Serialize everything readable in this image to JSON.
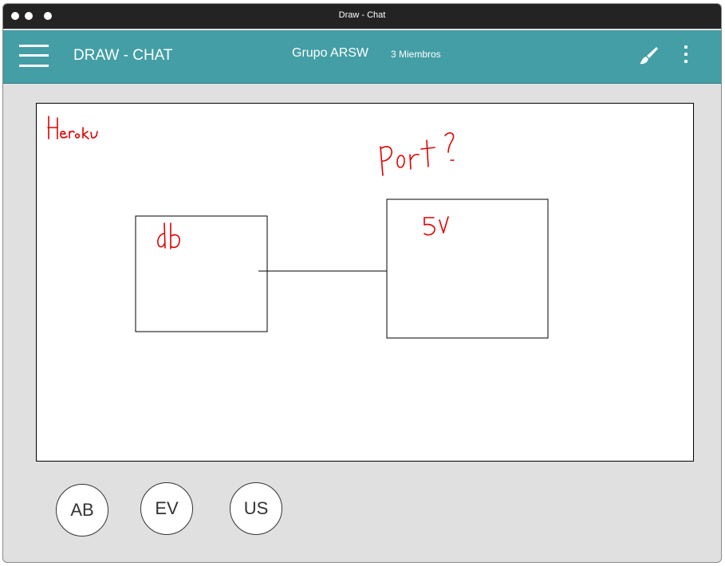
{
  "window": {
    "title": "Draw - Chat"
  },
  "appbar": {
    "app_name": "DRAW - CHAT",
    "group_name": "Grupo ARSW",
    "members": "3 Miembros",
    "color": "#439ea5"
  },
  "canvas": {
    "annotations": [
      "Heroku",
      "Port?",
      "db",
      "SV"
    ],
    "stroke_color": "#e00000"
  },
  "members_list": [
    {
      "initials": "AB"
    },
    {
      "initials": "EV"
    },
    {
      "initials": "US"
    }
  ],
  "icons": [
    "menu-icon",
    "brush-icon",
    "more-vert-icon"
  ]
}
